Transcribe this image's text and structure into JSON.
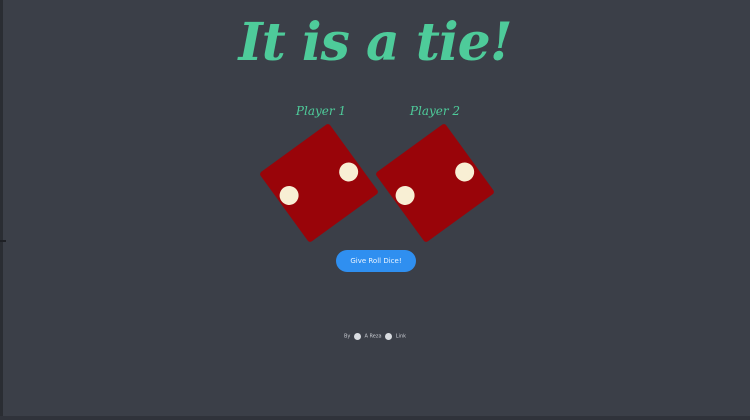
{
  "game": {
    "title": "It is a tie!",
    "players": [
      {
        "label": "Player 1",
        "die_value": 2
      },
      {
        "label": "Player 2",
        "die_value": 2
      }
    ],
    "roll_button_label": "Give Roll Dice!"
  },
  "footer": {
    "prefix": "By",
    "author_name": "A Reza",
    "link_text": "Link"
  },
  "colors": {
    "background": "#3b3f48",
    "accent": "#4ecb9a",
    "die": "#990409",
    "pip": "#f8efd4",
    "button": "#2f8ff0"
  }
}
